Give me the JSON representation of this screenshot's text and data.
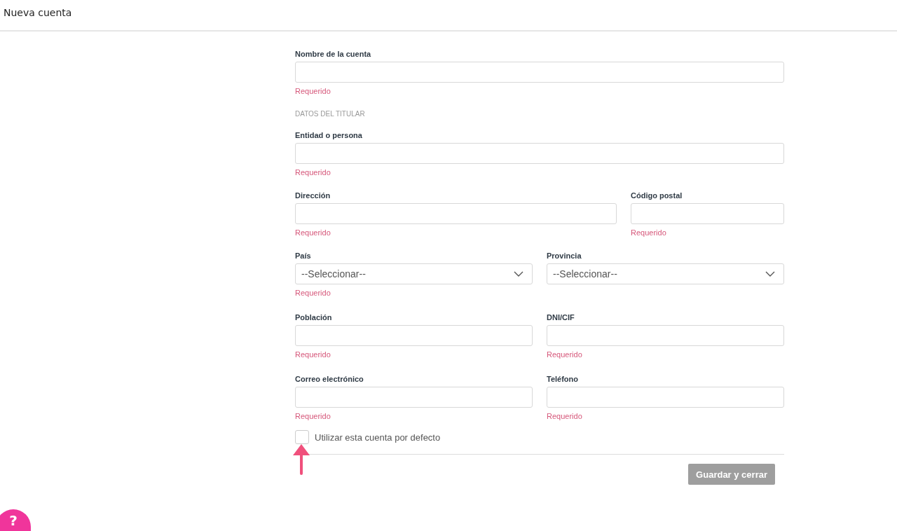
{
  "title": "Nueva cuenta",
  "rows": [
    {
      "kind": "single",
      "fields": [
        {
          "label": "Nombre de la cuenta",
          "kind": "text",
          "error": "Requerido"
        }
      ]
    },
    {
      "kind": "section",
      "text": "DATOS DEL TITULAR"
    },
    {
      "kind": "single",
      "fields": [
        {
          "label": "Entidad o persona",
          "kind": "text",
          "error": "Requerido"
        }
      ]
    },
    {
      "kind": "main-side",
      "fields": [
        {
          "label": "Dirección",
          "kind": "text",
          "error": "Requerido"
        },
        {
          "label": "Código postal",
          "kind": "text",
          "error": "Requerido"
        }
      ]
    },
    {
      "kind": "pair",
      "fields": [
        {
          "label": "País",
          "kind": "select",
          "placeholder": "--Seleccionar--",
          "error": "Requerido"
        },
        {
          "label": "Provincia",
          "kind": "select",
          "placeholder": "--Seleccionar--"
        }
      ]
    },
    {
      "kind": "pair",
      "fields": [
        {
          "label": "Población",
          "kind": "text",
          "error": "Requerido"
        },
        {
          "label": "DNI/CIF",
          "kind": "text",
          "error": "Requerido"
        }
      ]
    },
    {
      "kind": "pair",
      "fields": [
        {
          "label": "Correo electrónico",
          "kind": "text",
          "error": "Requerido"
        },
        {
          "label": "Teléfono",
          "kind": "text",
          "error": "Requerido"
        }
      ]
    }
  ],
  "default_checkbox": {
    "label": "Utilizar esta cuenta por defecto",
    "checked": false
  },
  "save_button": {
    "label": "Guardar y cerrar",
    "disabled": true
  },
  "help_button": {
    "label": "?"
  }
}
